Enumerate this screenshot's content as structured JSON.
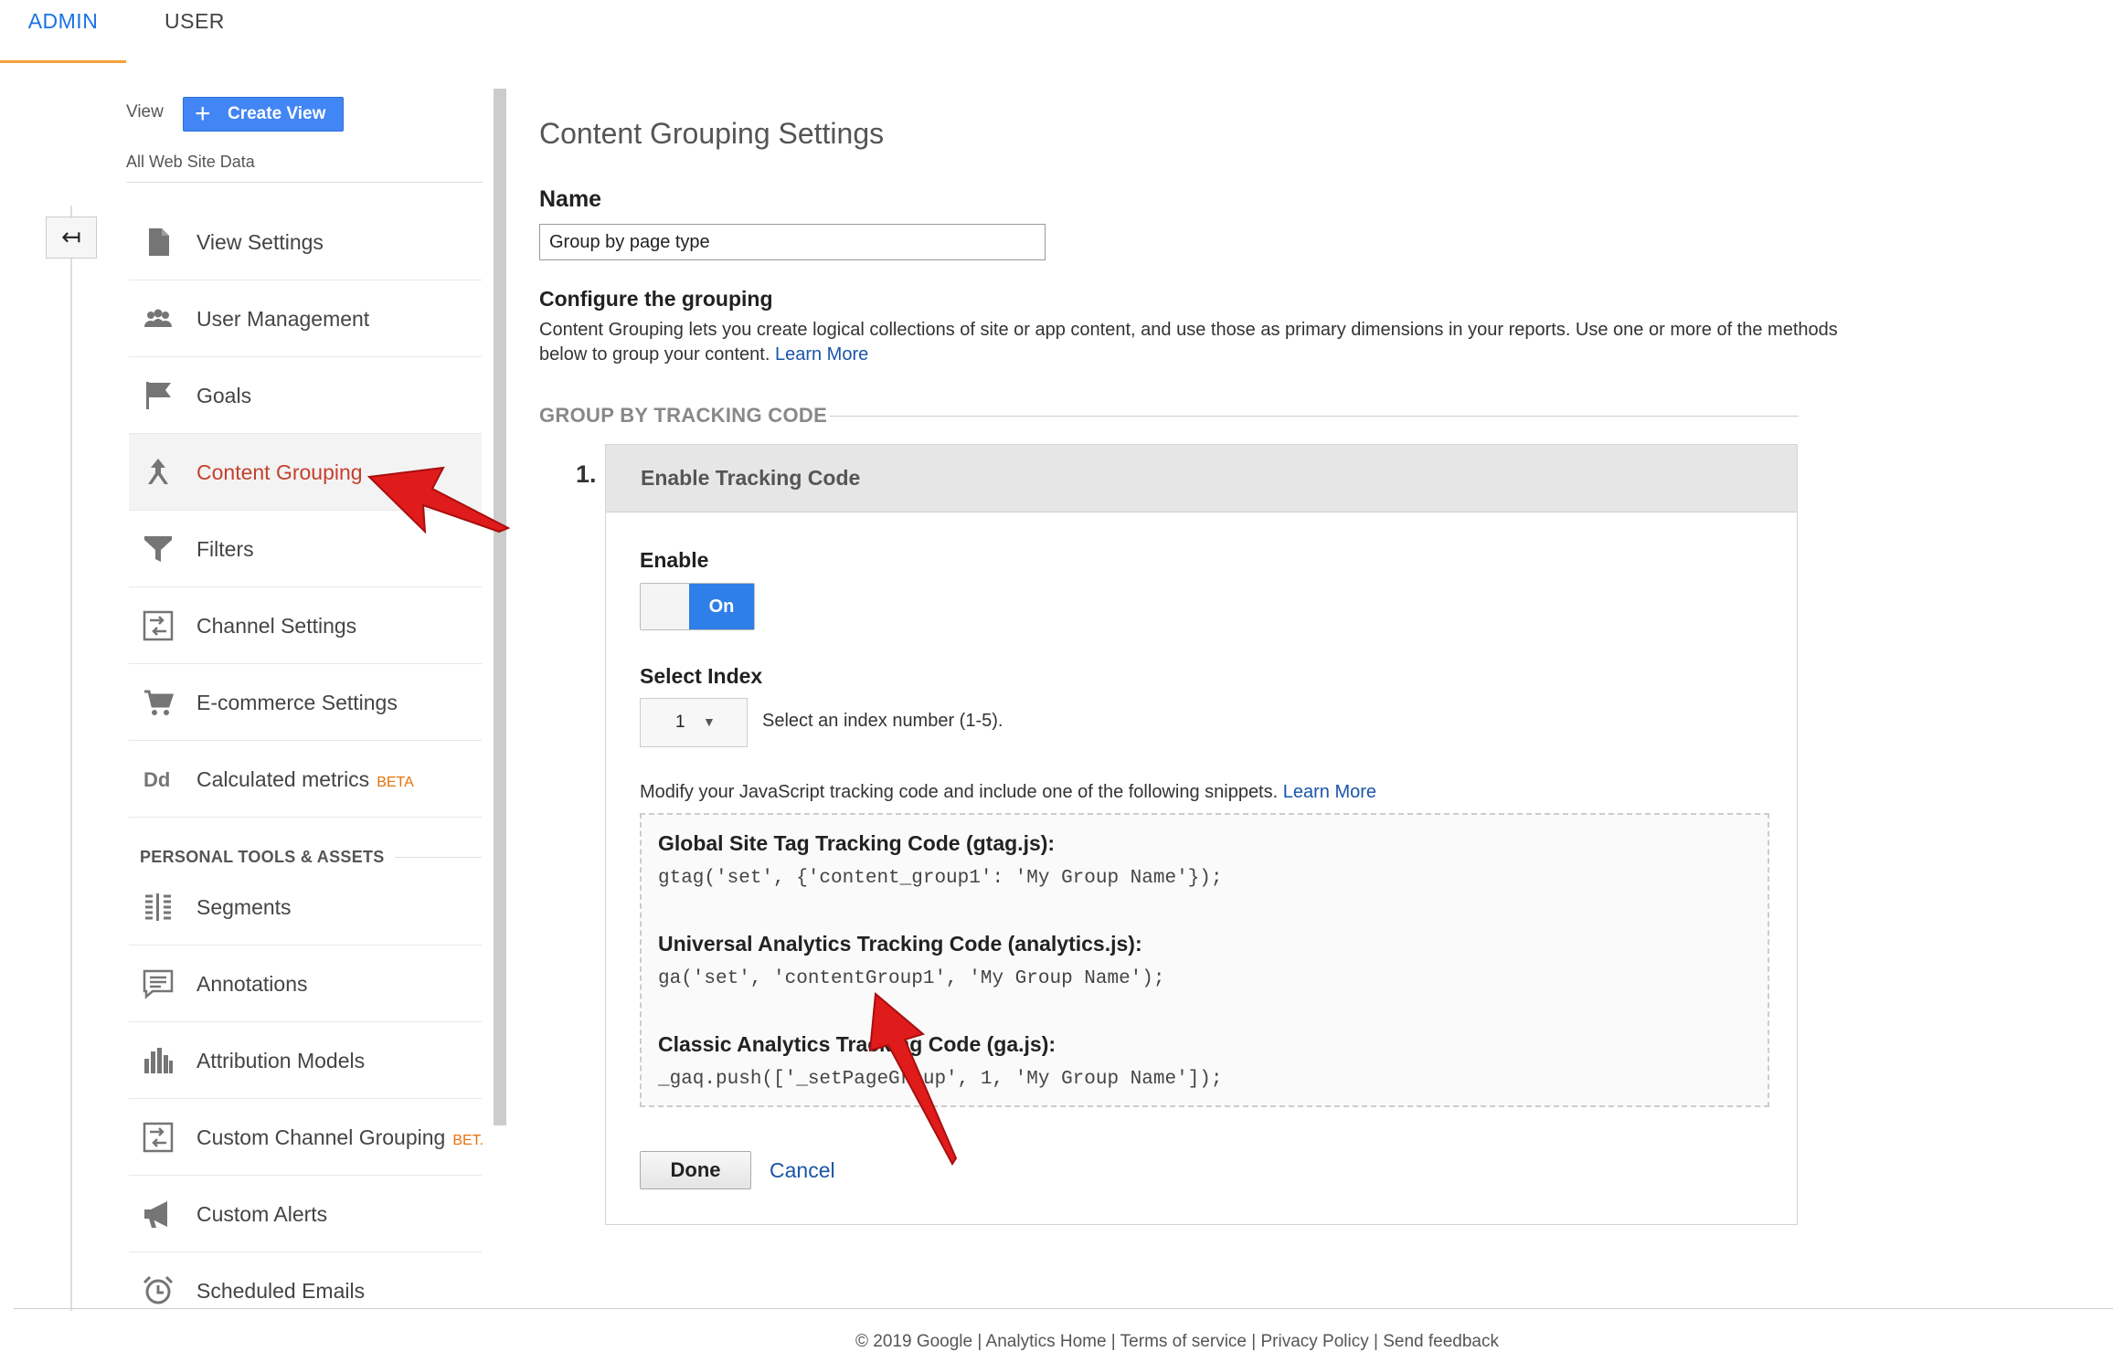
{
  "tabs": [
    {
      "label": "ADMIN",
      "active": true
    },
    {
      "label": "USER",
      "active": false
    }
  ],
  "view": {
    "label": "View",
    "create_button": "Create View",
    "name": "All Web Site Data"
  },
  "nav": {
    "items": [
      {
        "label": "View Settings",
        "icon": "document-icon"
      },
      {
        "label": "User Management",
        "icon": "people-icon"
      },
      {
        "label": "Goals",
        "icon": "flag-icon"
      },
      {
        "label": "Content Grouping",
        "icon": "content-grouping-icon",
        "active": true
      },
      {
        "label": "Filters",
        "icon": "filter-icon"
      },
      {
        "label": "Channel Settings",
        "icon": "channel-icon"
      },
      {
        "label": "E-commerce Settings",
        "icon": "cart-icon"
      },
      {
        "label": "Calculated metrics",
        "icon": "dd-icon",
        "badge": "BETA"
      }
    ],
    "personal_heading": "PERSONAL TOOLS & ASSETS",
    "personal_items": [
      {
        "label": "Segments",
        "icon": "segments-icon"
      },
      {
        "label": "Annotations",
        "icon": "annotation-icon"
      },
      {
        "label": "Attribution Models",
        "icon": "bar-chart-icon"
      },
      {
        "label": "Custom Channel Grouping",
        "icon": "channel-icon",
        "badge": "BET."
      },
      {
        "label": "Custom Alerts",
        "icon": "megaphone-icon"
      },
      {
        "label": "Scheduled Emails",
        "icon": "alarm-clock-icon"
      }
    ]
  },
  "main": {
    "title": "Content Grouping Settings",
    "name_label": "Name",
    "name_value": "Group by page type",
    "config_label": "Configure the grouping",
    "config_desc": "Content Grouping lets you create logical collections of site or app content, and use those as primary dimensions in your reports. Use one or more of the methods below to group your content.",
    "learn_more": "Learn More",
    "group_heading": "GROUP BY TRACKING CODE",
    "step_number": "1.",
    "panel_title": "Enable Tracking Code",
    "enable_label": "Enable",
    "toggle_on": "On",
    "index_label": "Select Index",
    "index_value": "1",
    "index_help": "Select an index number (1-5).",
    "modify_text": "Modify your JavaScript tracking code and include one of the following snippets.",
    "snippets": [
      {
        "title": "Global Site Tag Tracking Code (gtag.js):",
        "code": "gtag('set', {'content_group1': 'My Group Name'});"
      },
      {
        "title": "Universal Analytics Tracking Code (analytics.js):",
        "code": "ga('set', 'contentGroup1', 'My Group Name');"
      },
      {
        "title": "Classic Analytics Tracking Code (ga.js):",
        "code": "_gaq.push(['_setPageGroup', 1, 'My Group Name']);"
      }
    ],
    "done_button": "Done",
    "cancel_link": "Cancel"
  },
  "footer": "© 2019 Google | Analytics Home | Terms of service | Privacy Policy | Send feedback",
  "colors": {
    "accent_blue": "#1a73e8",
    "active_red": "#c5402e",
    "tab_underline": "#f4a13a",
    "annotation_red": "#e01b1b"
  }
}
